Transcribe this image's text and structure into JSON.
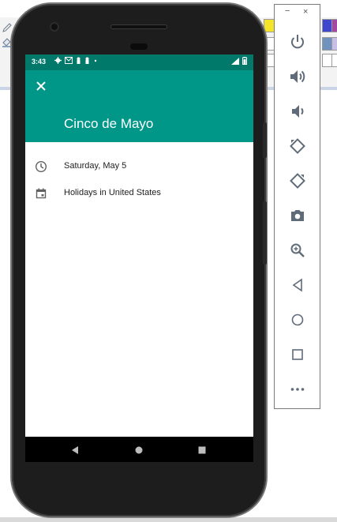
{
  "status_bar": {
    "time": "3:43"
  },
  "event": {
    "title": "Cinco de Mayo",
    "date": "Saturday, May 5",
    "calendar": "Holidays in United States"
  },
  "emulator": {
    "minimize": "−",
    "close": "×"
  },
  "colors": {
    "status_bar": "#00796b",
    "app_bar": "#009688",
    "icon_gray": "#616161",
    "emu_icon": "#5f6b78"
  }
}
